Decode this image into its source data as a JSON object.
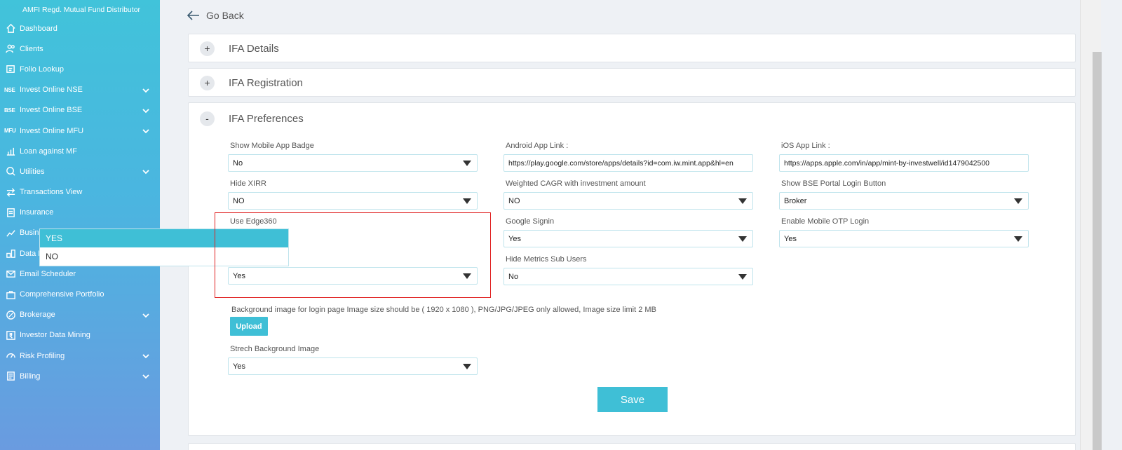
{
  "sidebar": {
    "brand": "AMFI Regd. Mutual Fund Distributor",
    "items": [
      {
        "label": "Dashboard",
        "icon": "home-icon"
      },
      {
        "label": "Clients",
        "icon": "users-icon"
      },
      {
        "label": "Folio Lookup",
        "icon": "folio-icon"
      },
      {
        "label": "Invest Online NSE",
        "tag": "NSE",
        "expandable": true
      },
      {
        "label": "Invest Online BSE",
        "tag": "BSE",
        "expandable": true
      },
      {
        "label": "Invest Online MFU",
        "tag": "MFU",
        "expandable": true
      },
      {
        "label": "Loan against MF",
        "icon": "loan-icon"
      },
      {
        "label": "Utilities",
        "icon": "utilities-icon",
        "expandable": true
      },
      {
        "label": "Transactions View",
        "icon": "transfer-icon"
      },
      {
        "label": "Insurance",
        "icon": "insurance-icon"
      },
      {
        "label": "Business Analytics",
        "icon": "analytics-icon"
      },
      {
        "label": "Data Management",
        "icon": "data-management-icon"
      },
      {
        "label": "Email Scheduler",
        "icon": "email-icon"
      },
      {
        "label": "Comprehensive Portfolio",
        "icon": "portfolio-icon"
      },
      {
        "label": "Brokerage",
        "icon": "brokerage-icon",
        "expandable": true
      },
      {
        "label": "Investor Data Mining",
        "icon": "rupee-icon"
      },
      {
        "label": "Risk Profiling",
        "icon": "gauge-icon",
        "expandable": true
      },
      {
        "label": "Billing",
        "icon": "billing-icon",
        "expandable": true
      }
    ]
  },
  "header": {
    "go_back": "Go Back"
  },
  "panels": {
    "ifa_details": {
      "title": "IFA Details",
      "toggle": "+"
    },
    "ifa_registration": {
      "title": "IFA Registration",
      "toggle": "+"
    },
    "ifa_preferences": {
      "title": "IFA Preferences",
      "toggle": "-"
    }
  },
  "preferences": {
    "show_mobile_app_badge": {
      "label": "Show Mobile App Badge",
      "value": "No"
    },
    "android_app_link": {
      "label": "Android App Link :",
      "value": "https://play.google.com/store/apps/details?id=com.iw.mint.app&hl=en"
    },
    "ios_app_link": {
      "label": "iOS App Link :",
      "value": "https://apps.apple.com/in/app/mint-by-investwell/id1479042500"
    },
    "hide_xirr": {
      "label": "Hide XIRR",
      "value": "NO"
    },
    "weighted_cagr": {
      "label": "Weighted CAGR with investment amount",
      "value": "NO"
    },
    "show_bse_login": {
      "label": "Show BSE Portal Login Button",
      "value": "Broker"
    },
    "use_edge360": {
      "label": "Use Edge360",
      "value": "Yes",
      "options": [
        "YES",
        "NO"
      ]
    },
    "google_signin": {
      "label": "Google Signin",
      "value": "Yes"
    },
    "enable_mobile_otp": {
      "label": "Enable Mobile OTP Login",
      "value": "Yes"
    },
    "hide_metrics_sub_users": {
      "label": "Hide Metrics Sub Users",
      "value": "No"
    },
    "background_note": "Background image for login page Image size should be ( 1920 x 1080 ), PNG/JPG/JPEG only allowed, Image size limit 2 MB",
    "upload_label": "Upload",
    "stretch_bg": {
      "label": "Strech Background Image",
      "value": "Yes"
    },
    "save_label": "Save"
  },
  "colors": {
    "accent": "#3fbfd6",
    "highlight": "#e02020"
  }
}
